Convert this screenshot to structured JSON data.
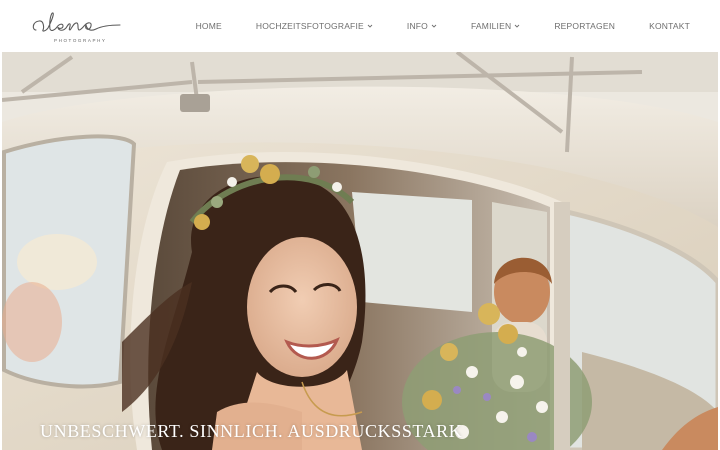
{
  "brand": {
    "logo_text": "alena",
    "logo_subtext": "PHOTOGRAPHY"
  },
  "nav": {
    "items": [
      {
        "label": "HOME",
        "has_dropdown": false
      },
      {
        "label": "HOCHZEITSFOTOGRAFIE",
        "has_dropdown": true
      },
      {
        "label": "INFO",
        "has_dropdown": true
      },
      {
        "label": "FAMILIEN",
        "has_dropdown": true
      },
      {
        "label": "REPORTAGEN",
        "has_dropdown": false
      },
      {
        "label": "KONTAKT",
        "has_dropdown": false
      }
    ]
  },
  "hero": {
    "image_alt": "",
    "tagline": "UNBESCHWERT. SINNLICH. AUSDRUCKSSTARK"
  },
  "colors": {
    "nav_text": "#6e6e6e",
    "background": "#ffffff",
    "tagline": "#ffffff"
  }
}
